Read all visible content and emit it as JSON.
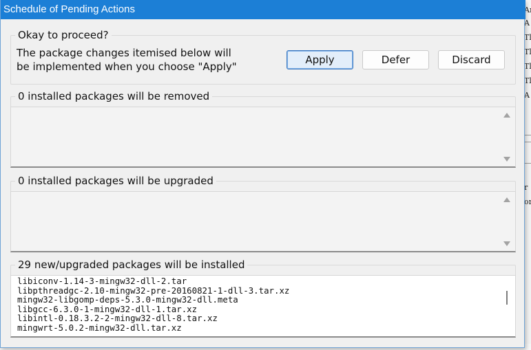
{
  "dialog": {
    "title": "Schedule of Pending Actions"
  },
  "proceed": {
    "heading": "Okay to proceed?",
    "description_line1": "The package changes itemised below will",
    "description_line2": "be implemented when you choose \"Apply\"",
    "apply_label": "Apply",
    "defer_label": "Defer",
    "discard_label": "Discard"
  },
  "removed": {
    "heading": "0 installed packages will be removed",
    "items": []
  },
  "upgraded": {
    "heading": "0 installed packages will be upgraded",
    "items": []
  },
  "installed": {
    "heading": "29 new/upgraded packages will be installed",
    "items": [
      "libiconv-1.14-3-mingw32-dll-2.tar",
      "libpthreadgc-2.10-mingw32-pre-20160821-1-dll-3.tar.xz",
      "mingw32-libgomp-deps-5.3.0-mingw32-dll.meta",
      "libgcc-6.3.0-1-mingw32-dll-1.tar.xz",
      "libintl-0.18.3.2-2-mingw32-dll-8.tar.xz",
      "mingwrt-5.0.2-mingw32-dll.tar.xz"
    ]
  },
  "background_window": {
    "glyphs": [
      "Ar",
      "A",
      "Tl",
      "Tl",
      "Tl",
      "Tl",
      "A"
    ],
    "glyphs_lower": [
      "r",
      "or"
    ]
  },
  "colors": {
    "titlebar": "#1c7fd6",
    "dialog_bg": "#f0f0f0",
    "default_button_border": "#3c78c0"
  }
}
